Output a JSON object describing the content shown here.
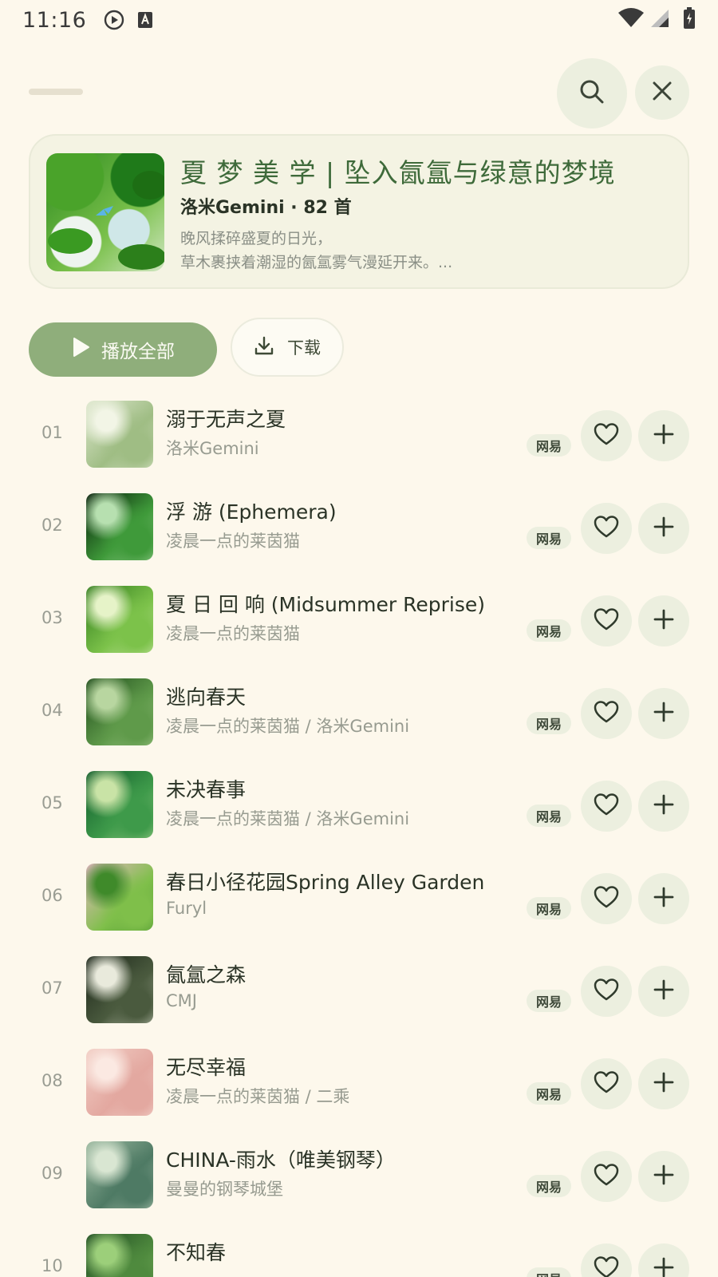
{
  "status_bar": {
    "time": "11:16"
  },
  "playlist": {
    "title": "夏 梦 美 学 | 坠入氤氲与绿意的梦境",
    "meta": "洛米Gemini · 82 首",
    "description_line1": "晚风揉碎盛夏的日光，",
    "description_line2": "草木裹挟着潮湿的氤氲雾气漫延开来。..."
  },
  "actions": {
    "play_all_label": "播放全部",
    "download_label": "下载"
  },
  "songs": [
    {
      "num": "01",
      "title": "溺于无声之夏",
      "artist": "洛米Gemini",
      "source": "网易",
      "cover_colors": [
        "#dfe8cf",
        "#9fbd84",
        "#f2f5e6"
      ]
    },
    {
      "num": "02",
      "title": "浮 游 (Ephemera)",
      "artist": "凌晨一点的莱茵猫",
      "source": "网易",
      "cover_colors": [
        "#041a08",
        "#3f9a3a",
        "#b7e0b0"
      ]
    },
    {
      "num": "03",
      "title": "夏 日 回 响 (Midsummer Reprise)",
      "artist": "凌晨一点的莱茵猫",
      "source": "网易",
      "cover_colors": [
        "#2f7a1c",
        "#7cc24a",
        "#e6f3c8"
      ]
    },
    {
      "num": "04",
      "title": "逃向春天",
      "artist": "凌晨一点的莱茵猫 / 洛米Gemini",
      "source": "网易",
      "cover_colors": [
        "#1d4a1a",
        "#5f9a4a",
        "#b8d6a0"
      ]
    },
    {
      "num": "05",
      "title": "未决春事",
      "artist": "凌晨一点的莱茵猫 / 洛米Gemini",
      "source": "网易",
      "cover_colors": [
        "#0f5a2a",
        "#3e9a4a",
        "#c9e3a6"
      ]
    },
    {
      "num": "06",
      "title": "春日小径花园Spring Alley Garden",
      "artist": "Furyl",
      "source": "网易",
      "cover_colors": [
        "#e8b7c7",
        "#7fbf4a",
        "#3f8a2a"
      ]
    },
    {
      "num": "07",
      "title": "氤氲之森",
      "artist": "CMJ",
      "source": "网易",
      "cover_colors": [
        "#1a2418",
        "#4a5a3e",
        "#e9eadc"
      ]
    },
    {
      "num": "08",
      "title": "无尽幸福",
      "artist": "凌晨一点的莱茵猫 / 二乘",
      "source": "网易",
      "cover_colors": [
        "#f2cfc6",
        "#e3a8a0",
        "#fbe9e2"
      ]
    },
    {
      "num": "09",
      "title": "CHINA-雨水（唯美钢琴）",
      "artist": "曼曼的钢琴城堡",
      "source": "网易",
      "cover_colors": [
        "#9cb9a0",
        "#4e7a64",
        "#d9e6d2"
      ]
    },
    {
      "num": "10",
      "title": "不知春",
      "artist": "",
      "source": "网易",
      "cover_colors": [
        "#1e4a22",
        "#4f8a3e",
        "#9ccf7a"
      ]
    }
  ],
  "icons": {
    "search": "search-icon",
    "close": "close-icon",
    "play": "play-icon",
    "download": "download-icon",
    "heart": "heart-icon",
    "plus": "plus-icon"
  },
  "colors": {
    "accent": "#8fae7b",
    "title_green": "#3e6a3a",
    "background": "#fdf8ec"
  }
}
